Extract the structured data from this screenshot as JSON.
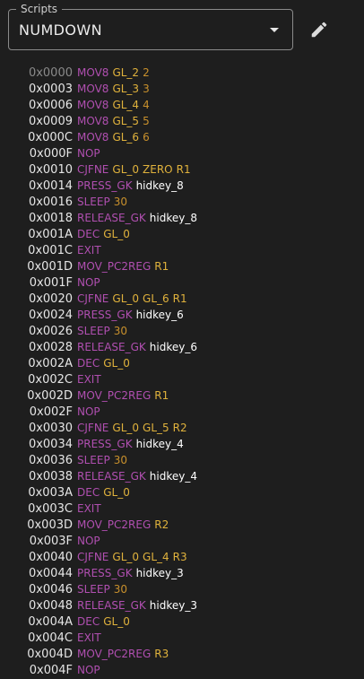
{
  "select": {
    "label": "Scripts",
    "value": "NUMDOWN"
  },
  "icons": {
    "dropdown": "arrow-drop-down-icon",
    "edit": "pencil-icon"
  },
  "colors": {
    "opcode": "#b04fb0",
    "register": "#e0b23c",
    "number": "#c8902c",
    "key": "#ffffff",
    "address": "#e6e6e6"
  },
  "lines": [
    {
      "addr": "0x0000",
      "op": "MOV8",
      "args": [
        {
          "t": "GL_2",
          "k": "reg"
        },
        {
          "t": "2",
          "k": "num"
        }
      ]
    },
    {
      "addr": "0x0003",
      "op": "MOV8",
      "args": [
        {
          "t": "GL_3",
          "k": "reg"
        },
        {
          "t": "3",
          "k": "num"
        }
      ]
    },
    {
      "addr": "0x0006",
      "op": "MOV8",
      "args": [
        {
          "t": "GL_4",
          "k": "reg"
        },
        {
          "t": "4",
          "k": "num"
        }
      ]
    },
    {
      "addr": "0x0009",
      "op": "MOV8",
      "args": [
        {
          "t": "GL_5",
          "k": "reg"
        },
        {
          "t": "5",
          "k": "num"
        }
      ]
    },
    {
      "addr": "0x000C",
      "op": "MOV8",
      "args": [
        {
          "t": "GL_6",
          "k": "reg"
        },
        {
          "t": "6",
          "k": "num"
        }
      ]
    },
    {
      "addr": "0x000F",
      "op": "NOP",
      "args": []
    },
    {
      "addr": "0x0010",
      "op": "CJFNE",
      "args": [
        {
          "t": "GL_0",
          "k": "reg"
        },
        {
          "t": "ZERO",
          "k": "reg"
        },
        {
          "t": "R1",
          "k": "reg"
        }
      ]
    },
    {
      "addr": "0x0014",
      "op": "PRESS_GK",
      "args": [
        {
          "t": "hidkey_8",
          "k": "key"
        }
      ]
    },
    {
      "addr": "0x0016",
      "op": "SLEEP",
      "args": [
        {
          "t": "30",
          "k": "num"
        }
      ]
    },
    {
      "addr": "0x0018",
      "op": "RELEASE_GK",
      "args": [
        {
          "t": "hidkey_8",
          "k": "key"
        }
      ]
    },
    {
      "addr": "0x001A",
      "op": "DEC",
      "args": [
        {
          "t": "GL_0",
          "k": "reg"
        }
      ]
    },
    {
      "addr": "0x001C",
      "op": "EXIT",
      "args": []
    },
    {
      "addr": "0x001D",
      "op": "MOV_PC2REG",
      "args": [
        {
          "t": "R1",
          "k": "reg"
        }
      ]
    },
    {
      "addr": "0x001F",
      "op": "NOP",
      "args": []
    },
    {
      "addr": "0x0020",
      "op": "CJFNE",
      "args": [
        {
          "t": "GL_0",
          "k": "reg"
        },
        {
          "t": "GL_6",
          "k": "reg"
        },
        {
          "t": "R1",
          "k": "reg"
        }
      ]
    },
    {
      "addr": "0x0024",
      "op": "PRESS_GK",
      "args": [
        {
          "t": "hidkey_6",
          "k": "key"
        }
      ]
    },
    {
      "addr": "0x0026",
      "op": "SLEEP",
      "args": [
        {
          "t": "30",
          "k": "num"
        }
      ]
    },
    {
      "addr": "0x0028",
      "op": "RELEASE_GK",
      "args": [
        {
          "t": "hidkey_6",
          "k": "key"
        }
      ]
    },
    {
      "addr": "0x002A",
      "op": "DEC",
      "args": [
        {
          "t": "GL_0",
          "k": "reg"
        }
      ]
    },
    {
      "addr": "0x002C",
      "op": "EXIT",
      "args": []
    },
    {
      "addr": "0x002D",
      "op": "MOV_PC2REG",
      "args": [
        {
          "t": "R1",
          "k": "reg"
        }
      ]
    },
    {
      "addr": "0x002F",
      "op": "NOP",
      "args": []
    },
    {
      "addr": "0x0030",
      "op": "CJFNE",
      "args": [
        {
          "t": "GL_0",
          "k": "reg"
        },
        {
          "t": "GL_5",
          "k": "reg"
        },
        {
          "t": "R2",
          "k": "reg"
        }
      ]
    },
    {
      "addr": "0x0034",
      "op": "PRESS_GK",
      "args": [
        {
          "t": "hidkey_4",
          "k": "key"
        }
      ]
    },
    {
      "addr": "0x0036",
      "op": "SLEEP",
      "args": [
        {
          "t": "30",
          "k": "num"
        }
      ]
    },
    {
      "addr": "0x0038",
      "op": "RELEASE_GK",
      "args": [
        {
          "t": "hidkey_4",
          "k": "key"
        }
      ]
    },
    {
      "addr": "0x003A",
      "op": "DEC",
      "args": [
        {
          "t": "GL_0",
          "k": "reg"
        }
      ]
    },
    {
      "addr": "0x003C",
      "op": "EXIT",
      "args": []
    },
    {
      "addr": "0x003D",
      "op": "MOV_PC2REG",
      "args": [
        {
          "t": "R2",
          "k": "reg"
        }
      ]
    },
    {
      "addr": "0x003F",
      "op": "NOP",
      "args": []
    },
    {
      "addr": "0x0040",
      "op": "CJFNE",
      "args": [
        {
          "t": "GL_0",
          "k": "reg"
        },
        {
          "t": "GL_4",
          "k": "reg"
        },
        {
          "t": "R3",
          "k": "reg"
        }
      ]
    },
    {
      "addr": "0x0044",
      "op": "PRESS_GK",
      "args": [
        {
          "t": "hidkey_3",
          "k": "key"
        }
      ]
    },
    {
      "addr": "0x0046",
      "op": "SLEEP",
      "args": [
        {
          "t": "30",
          "k": "num"
        }
      ]
    },
    {
      "addr": "0x0048",
      "op": "RELEASE_GK",
      "args": [
        {
          "t": "hidkey_3",
          "k": "key"
        }
      ]
    },
    {
      "addr": "0x004A",
      "op": "DEC",
      "args": [
        {
          "t": "GL_0",
          "k": "reg"
        }
      ]
    },
    {
      "addr": "0x004C",
      "op": "EXIT",
      "args": []
    },
    {
      "addr": "0x004D",
      "op": "MOV_PC2REG",
      "args": [
        {
          "t": "R3",
          "k": "reg"
        }
      ]
    },
    {
      "addr": "0x004F",
      "op": "NOP",
      "args": []
    }
  ]
}
